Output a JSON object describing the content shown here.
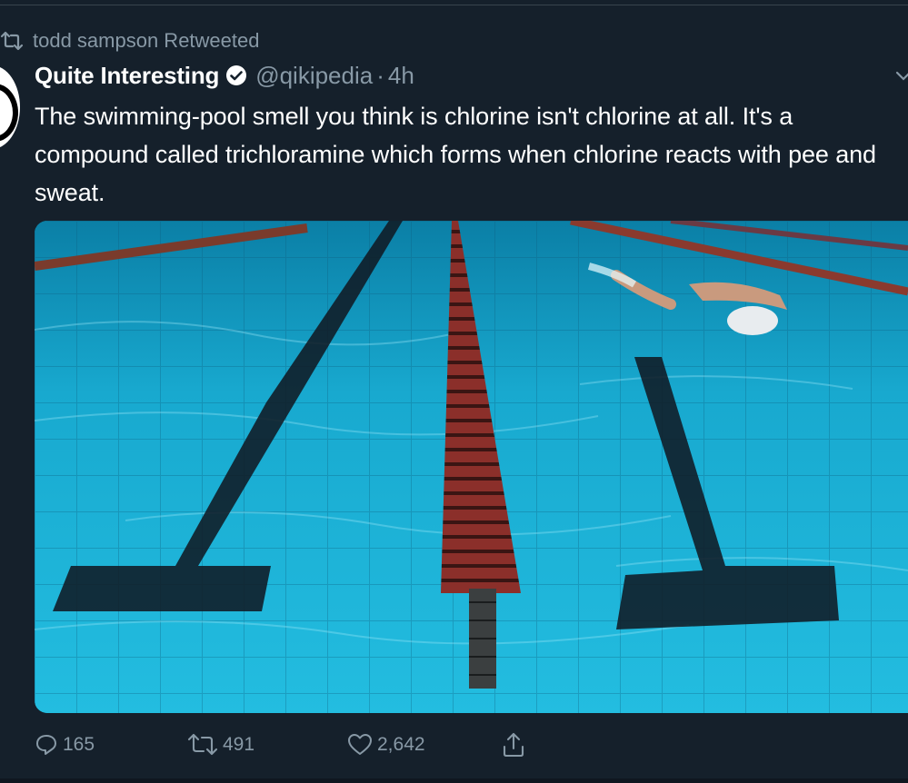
{
  "retweet": {
    "text": "todd sampson Retweeted"
  },
  "tweet": {
    "display_name": "Quite Interesting",
    "handle": "@qikipedia",
    "separator": "·",
    "time": "4h",
    "text": "The swimming-pool smell you think is chlorine isn't chlorine at all. It's a compound called trichloramine which forms when chlorine reacts with pee and sweat.",
    "media": {
      "icon": "photo-swimming-pool"
    }
  },
  "actions": {
    "reply_count": "165",
    "retweet_count": "491",
    "like_count": "2,642"
  },
  "colors": {
    "background": "#15202b",
    "secondary_text": "#8899a6",
    "primary_text": "#ffffff",
    "pool_water": "#1aa6c8"
  }
}
